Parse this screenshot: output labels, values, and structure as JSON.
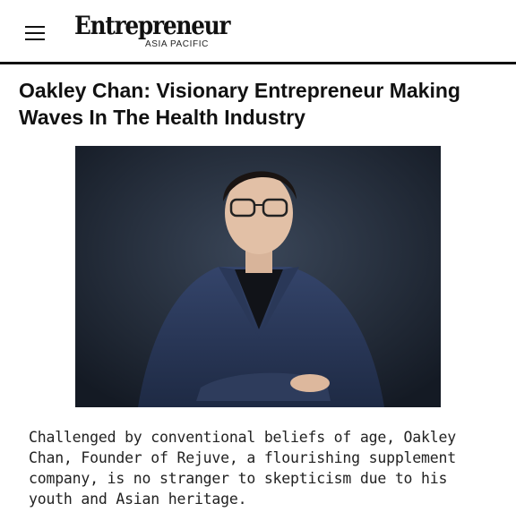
{
  "header": {
    "menu_icon": "hamburger-menu-icon",
    "logo_text": "Entrepreneur",
    "logo_subtext": "ASIA PACIFIC"
  },
  "article": {
    "title": "Oakley Chan: Visionary Entrepreneur Making Waves In The Health Industry",
    "excerpt": "Challenged by conventional beliefs of age, Oakley Chan, Founder of Rejuve, a flourishing supplement company, is no stranger to skepticism due to his youth and Asian heritage."
  },
  "colors": {
    "text": "#111111",
    "divider": "#111111",
    "photo_background": "#1c2432",
    "suit": "#2c3a52"
  }
}
